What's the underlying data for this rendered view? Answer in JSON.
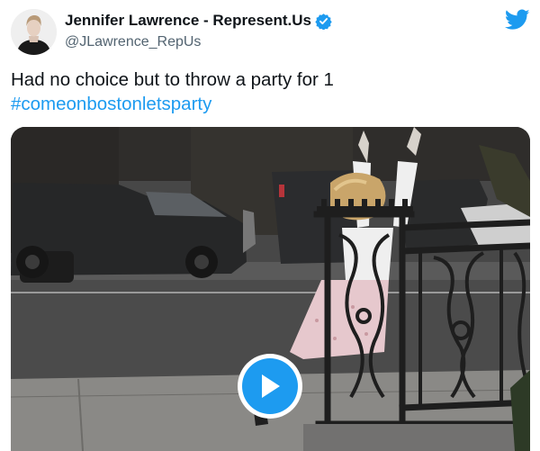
{
  "author": {
    "display_name": "Jennifer Lawrence - Represent.Us",
    "handle": "@JLawrence_RepUs",
    "avatar_icon": "profile-photo",
    "verified_icon": "verified-badge-icon",
    "verified_color": "#1d9bf0"
  },
  "brand": {
    "icon": "twitter-bird-icon",
    "color": "#1d9bf0"
  },
  "tweet": {
    "text": "Had no choice but to throw a party for 1",
    "hashtag": "#comeonbostonletsparty",
    "hashtag_color": "#1d9bf0"
  },
  "media": {
    "type": "video",
    "play_icon": "play-icon",
    "play_color": "#1d9bf0"
  }
}
